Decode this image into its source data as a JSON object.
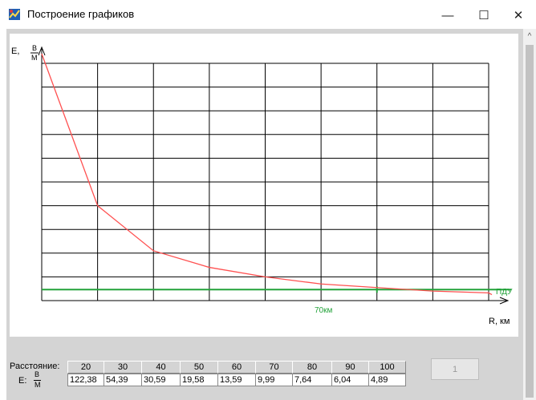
{
  "window": {
    "title": "Построение графиков",
    "minimize_glyph": "—",
    "maximize_glyph": "☐",
    "close_glyph": "✕",
    "icon": "app-chart-icon"
  },
  "chart_data": {
    "type": "line",
    "ylabel": "E, В/М",
    "ylabel_parts": {
      "symbol": "E,",
      "num": "В",
      "den": "М"
    },
    "xlabel": "R, км",
    "x": [
      10,
      20,
      30,
      40,
      50,
      60,
      70,
      80,
      90,
      100
    ],
    "xlim": [
      10,
      90
    ],
    "ylim": [
      0,
      200
    ],
    "grid": true,
    "series": [
      {
        "color": "#ff5050",
        "x": [
          10,
          20,
          30,
          40,
          50,
          60,
          70,
          80,
          90,
          100
        ],
        "values": [
          208,
          80,
          42,
          28,
          20,
          14,
          11,
          8,
          6.5,
          5
        ]
      }
    ],
    "threshold": {
      "label": "ПДУ",
      "value": 10,
      "color": "#23a23a"
    },
    "marker": {
      "label": "70км",
      "x": 70
    }
  },
  "table": {
    "distance_label": "Расстояние:",
    "e_label": {
      "symbol": "E:",
      "num": "В",
      "den": "М"
    },
    "distances": [
      "20",
      "30",
      "40",
      "50",
      "60",
      "70",
      "80",
      "90",
      "100"
    ],
    "values": [
      "122,38",
      "54,39",
      "30,59",
      "19,58",
      "13,59",
      "9,99",
      "7,64",
      "6,04",
      "4,89"
    ]
  },
  "button": {
    "label": "1"
  },
  "scrollbar": {
    "up_glyph": "^"
  }
}
